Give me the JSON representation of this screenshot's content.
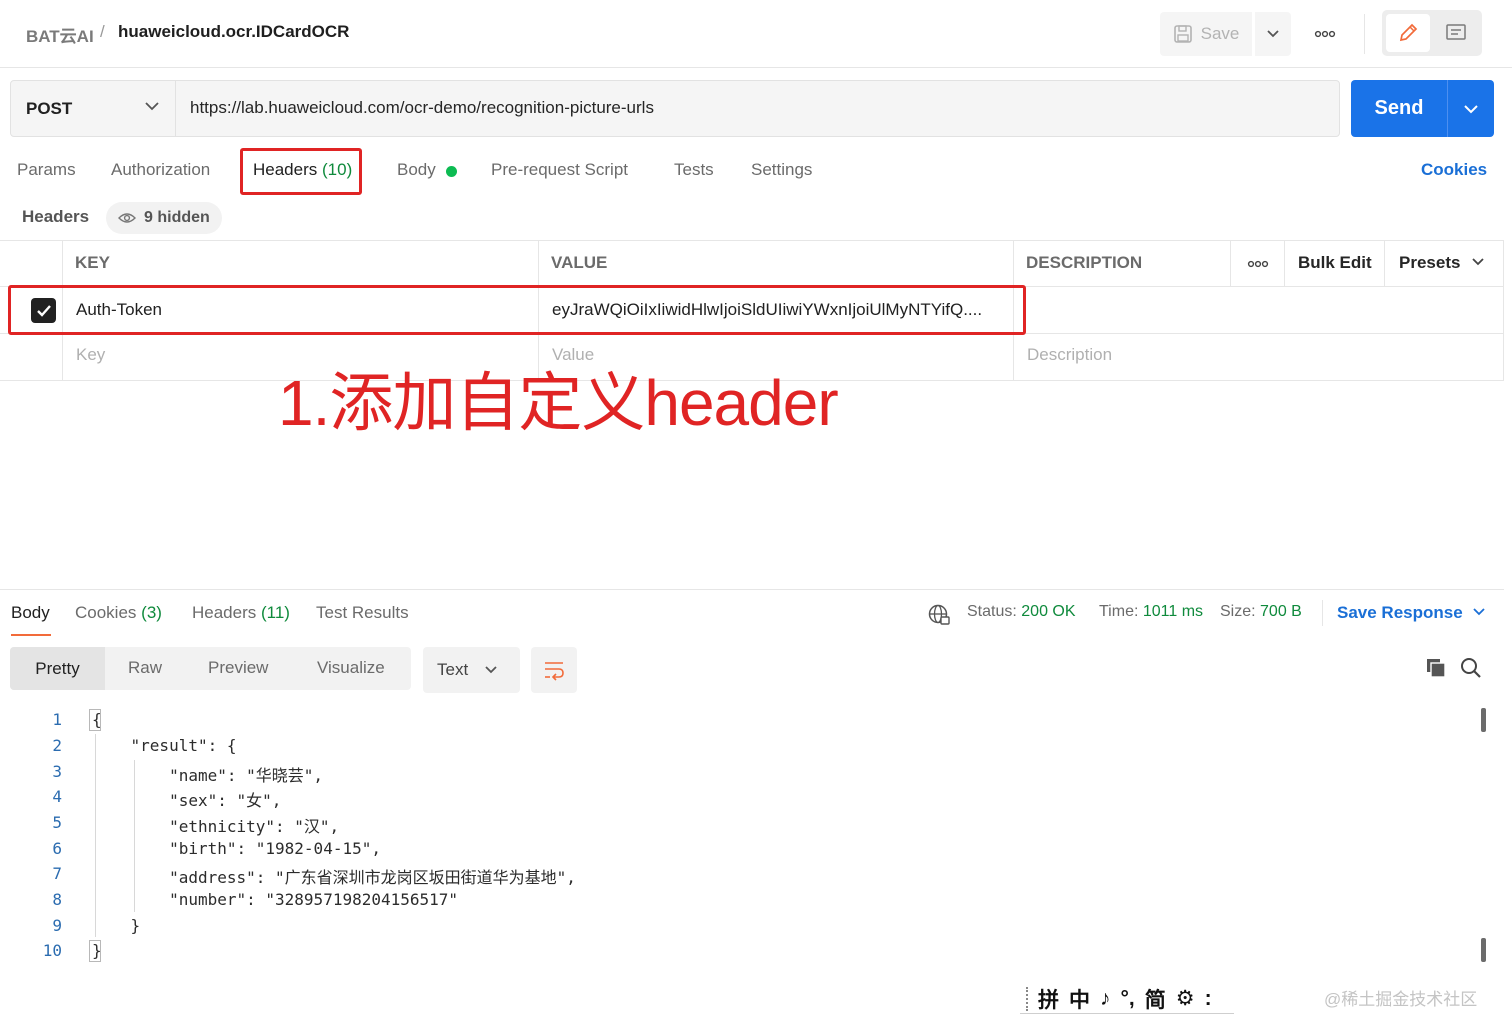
{
  "header": {
    "workspace": "BAT云AI",
    "separator": "/",
    "title": "huaweicloud.ocr.IDCardOCR",
    "save_label": "Save"
  },
  "request": {
    "method": "POST",
    "url": "https://lab.huaweicloud.com/ocr-demo/recognition-picture-urls",
    "send_label": "Send"
  },
  "request_tabs": {
    "params": "Params",
    "authorization": "Authorization",
    "headers": "Headers",
    "headers_count": "(10)",
    "body": "Body",
    "prerequest": "Pre-request Script",
    "tests": "Tests",
    "settings": "Settings",
    "cookies": "Cookies"
  },
  "headers_section": {
    "title": "Headers",
    "hidden_label": "9 hidden",
    "columns": {
      "key": "KEY",
      "value": "VALUE",
      "description": "DESCRIPTION"
    },
    "bulk_edit": "Bulk Edit",
    "presets": "Presets",
    "rows": [
      {
        "checked": true,
        "key": "Auth-Token",
        "value": "eyJraWQiOiIxIiwidHlwIjoiSldUIiwiYWxnIjoiUlMyNTYifQ...."
      }
    ],
    "placeholders": {
      "key": "Key",
      "value": "Value",
      "description": "Description"
    }
  },
  "annotation": {
    "text": "1.添加自定义header",
    "color": "#e02424"
  },
  "response": {
    "tabs": {
      "body": "Body",
      "cookies": "Cookies",
      "cookies_count": "(3)",
      "headers": "Headers",
      "headers_count": "(11)",
      "test_results": "Test Results"
    },
    "status_label": "Status:",
    "status_value": "200 OK",
    "time_label": "Time:",
    "time_value": "1011 ms",
    "size_label": "Size:",
    "size_value": "700 B",
    "save_response": "Save Response",
    "views": [
      "Pretty",
      "Raw",
      "Preview",
      "Visualize"
    ],
    "format": "Text",
    "lines": [
      "{",
      "    \"result\": {",
      "        \"name\": \"华晓芸\",",
      "        \"sex\": \"女\",",
      "        \"ethnicity\": \"汉\",",
      "        \"birth\": \"1982-04-15\",",
      "        \"address\": \"广东省深圳市龙岗区坂田街道华为基地\",",
      "        \"number\": \"328957198204156517\"",
      "    }",
      "}"
    ],
    "line_numbers": [
      "1",
      "2",
      "3",
      "4",
      "5",
      "6",
      "7",
      "8",
      "9",
      "10"
    ]
  },
  "ime_bar": [
    "拼",
    "中",
    "♪",
    "°,",
    "简",
    "⚙",
    ":"
  ],
  "watermark": "@稀土掘金技术社区",
  "colors": {
    "accent": "#1a73e8",
    "link": "#1a6fd6",
    "success": "#0f8a3c",
    "annotation": "#e02424",
    "tab_underline": "#f26b3a"
  }
}
